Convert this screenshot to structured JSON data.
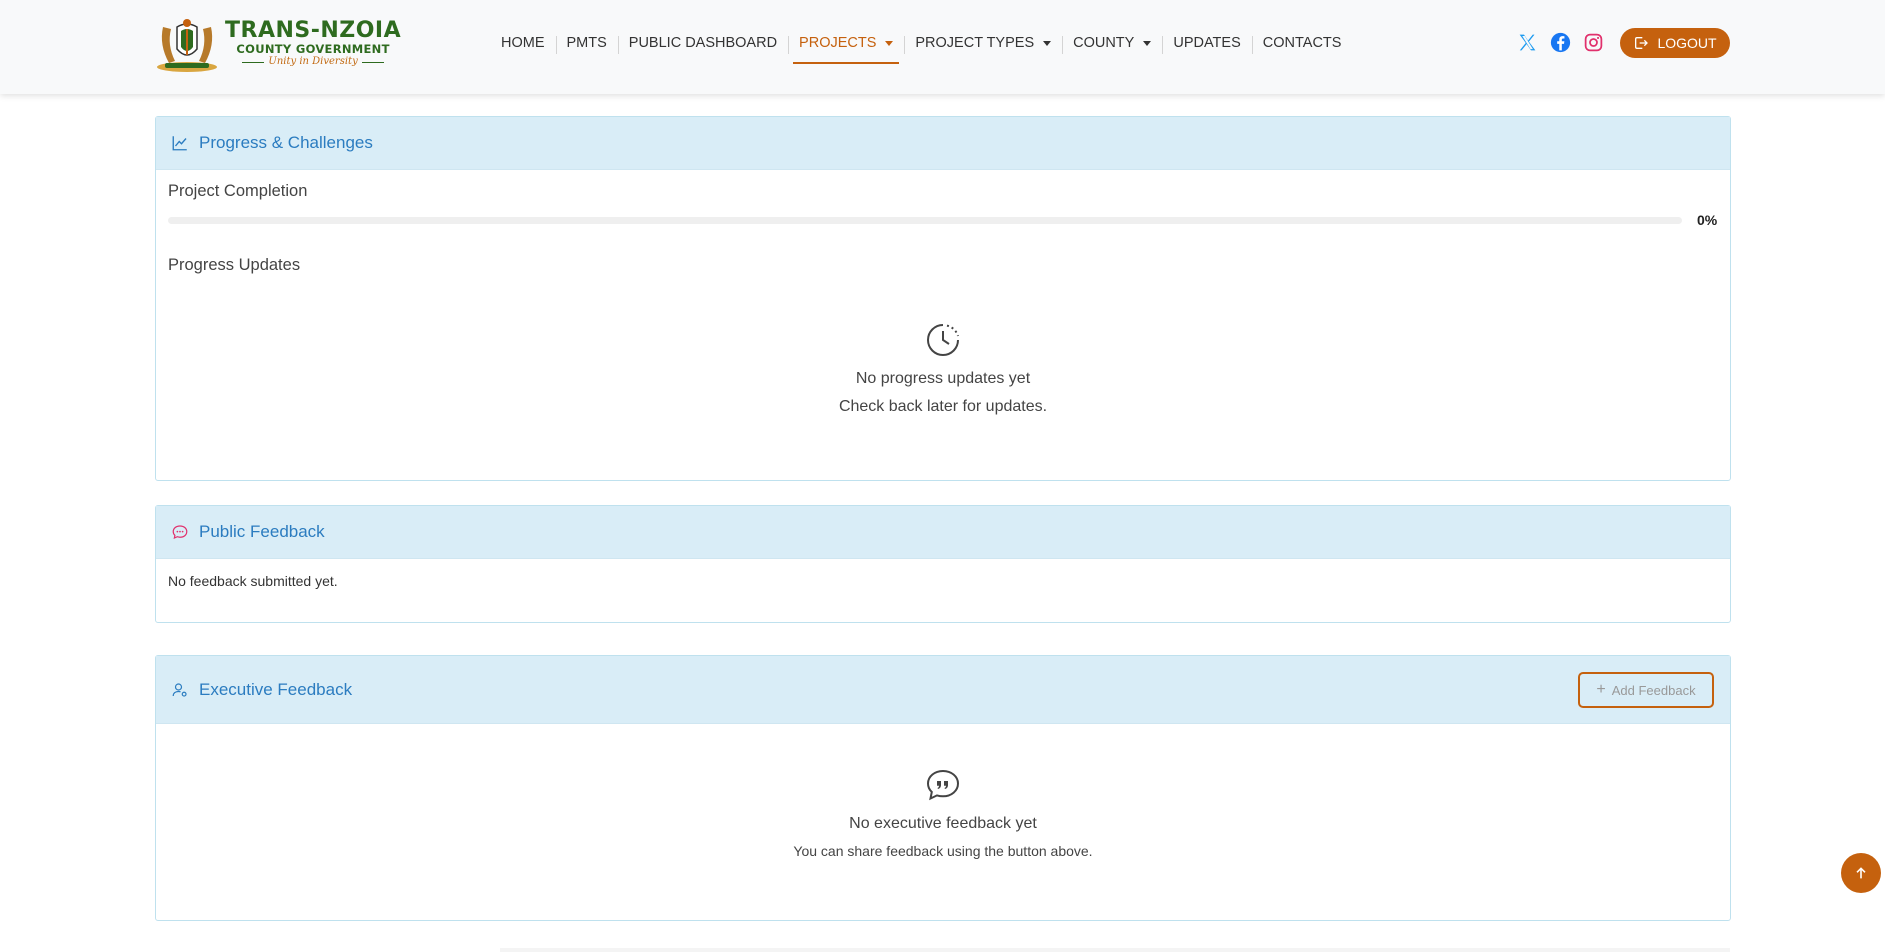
{
  "brand": {
    "title": "TRANS-NZOIA",
    "subtitle": "COUNTY GOVERNMENT",
    "motto": "Unity in Diversity"
  },
  "nav": {
    "items": [
      {
        "label": "HOME",
        "active": false,
        "dropdown": false
      },
      {
        "label": "PMTS",
        "active": false,
        "dropdown": false
      },
      {
        "label": "PUBLIC DASHBOARD",
        "active": false,
        "dropdown": false
      },
      {
        "label": "PROJECTS",
        "active": true,
        "dropdown": true
      },
      {
        "label": "PROJECT TYPES",
        "active": false,
        "dropdown": true
      },
      {
        "label": "COUNTY",
        "active": false,
        "dropdown": true
      },
      {
        "label": "UPDATES",
        "active": false,
        "dropdown": false
      },
      {
        "label": "CONTACTS",
        "active": false,
        "dropdown": false
      }
    ],
    "logout_label": "LOGOUT"
  },
  "social": {
    "icons": [
      "x-twitter-icon",
      "facebook-icon",
      "instagram-icon"
    ]
  },
  "progress_card": {
    "title": "Progress & Challenges",
    "completion_label": "Project Completion",
    "completion_pct": 0,
    "completion_text": "0%",
    "updates_label": "Progress Updates",
    "empty_title": "No progress updates yet",
    "empty_sub": "Check back later for updates."
  },
  "public_feedback": {
    "title": "Public Feedback",
    "empty": "No feedback submitted yet."
  },
  "executive_feedback": {
    "title": "Executive Feedback",
    "add_label": "Add Feedback",
    "empty_title": "No executive feedback yet",
    "empty_sub": "You can share feedback using the button above."
  },
  "colors": {
    "accent": "#c5610e",
    "header_bg": "#d9edf7",
    "title_blue": "#2b7cc0",
    "brand_green": "#2e6b1f"
  }
}
